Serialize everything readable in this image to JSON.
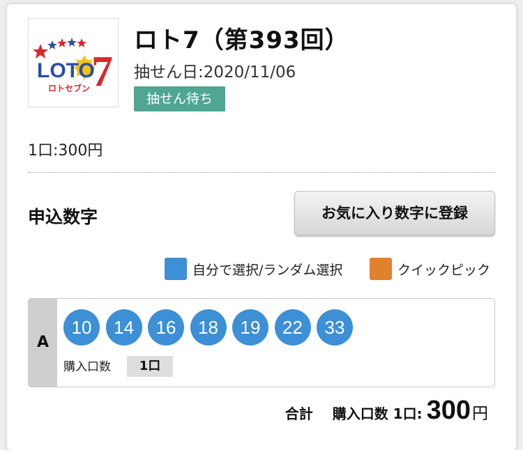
{
  "header": {
    "logo": {
      "text": "LOTO",
      "digit": "7",
      "subtitle": "ロトセブン",
      "icon": "loto7-logo"
    },
    "title": "ロト7（第393回）",
    "draw_date": "抽せん日:2020/11/06",
    "status": "抽せん待ち"
  },
  "price": {
    "unit_text": "1口:300円"
  },
  "selection": {
    "title": "申込数字",
    "favorite_button": "お気に入り数字に登録",
    "legend": [
      {
        "label": "自分で選択/ランダム選択",
        "color": "#3d8fd6"
      },
      {
        "label": "クイックピック",
        "color": "#e0812e"
      }
    ],
    "rows": [
      {
        "label": "A",
        "numbers": [
          "10",
          "14",
          "16",
          "18",
          "19",
          "22",
          "33"
        ],
        "count_label": "購入口数",
        "count_value": "1口"
      }
    ]
  },
  "total": {
    "label": "合計",
    "count_text": "購入口数 1口:",
    "amount": "300",
    "currency": "円"
  },
  "colors": {
    "status_badge": "#4ea693",
    "ball_blue": "#3d8fd6",
    "quick_pick_orange": "#e0812e"
  }
}
